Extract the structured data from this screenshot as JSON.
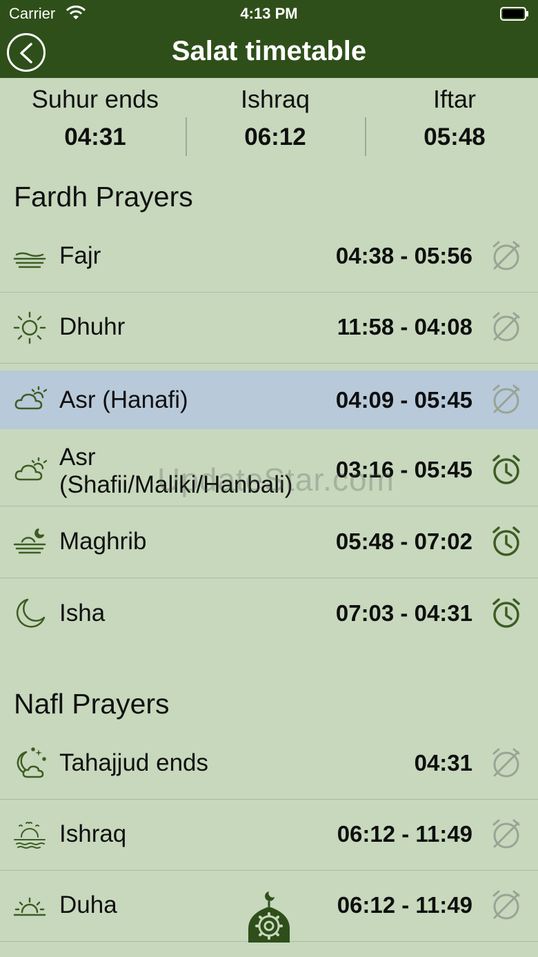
{
  "status_bar": {
    "carrier": "Carrier",
    "time": "4:13 PM"
  },
  "nav": {
    "title": "Salat timetable"
  },
  "summary": [
    {
      "label": "Suhur ends",
      "value": "04:31"
    },
    {
      "label": "Ishraq",
      "value": "06:12"
    },
    {
      "label": "Iftar",
      "value": "05:48"
    }
  ],
  "fardh": {
    "title": "Fardh Prayers",
    "rows": [
      {
        "name": "Fajr",
        "time": "04:38 - 05:56",
        "icon": "fajr-horizon-icon",
        "alarm_on": false
      },
      {
        "name": "Dhuhr",
        "time": "11:58 - 04:08",
        "icon": "sun-icon",
        "alarm_on": false
      },
      {
        "name": "Asr (Hanafi)",
        "time": "04:09 - 05:45",
        "icon": "cloud-sun-icon",
        "alarm_on": false
      },
      {
        "name": "Asr (Shafii/Maliki/Hanbali)",
        "time": "03:16 - 05:45",
        "icon": "cloud-sun-icon",
        "alarm_on": true
      },
      {
        "name": "Maghrib",
        "time": "05:48 - 07:02",
        "icon": "sunset-moon-icon",
        "alarm_on": true
      },
      {
        "name": "Isha",
        "time": "07:03 - 04:31",
        "icon": "crescent-moon-icon",
        "alarm_on": true
      }
    ]
  },
  "nafl": {
    "title": "Nafl Prayers",
    "rows": [
      {
        "name": "Tahajjud ends",
        "time": "04:31",
        "icon": "moon-cloud-stars-icon",
        "alarm_on": false
      },
      {
        "name": "Ishraq",
        "time": "06:12 - 11:49",
        "icon": "sunrise-birds-icon",
        "alarm_on": false
      },
      {
        "name": "Duha",
        "time": "06:12 - 11:49",
        "icon": "sunrise-icon",
        "alarm_on": false
      }
    ]
  },
  "watermark": "UpdateStar.com",
  "colors": {
    "bar": "#2f4f1a",
    "background": "#c7d8bd",
    "selected": "#b8c9da",
    "icon": "#3d5c22",
    "alarm_off": "#9aa394"
  }
}
